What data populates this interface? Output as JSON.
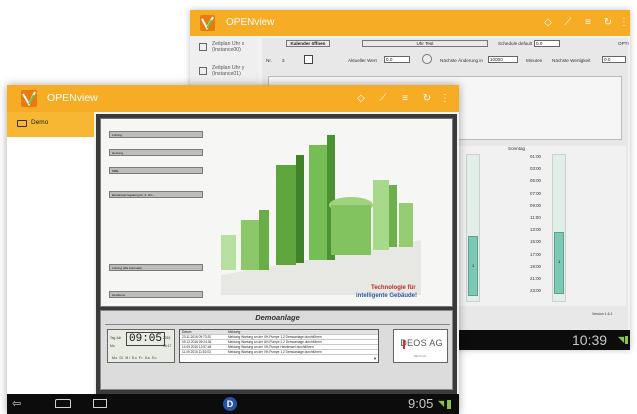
{
  "back_window": {
    "app_title": "OPENview",
    "sidebar_items": [
      {
        "label": "Zeitplan Uhr x (Instance00)"
      },
      {
        "label": "Zeitplan Uhr y (Instance01)"
      }
    ],
    "toolbar": {
      "kalender_button": "Kalender öffnen",
      "uhr_test_button": "Uhr Test",
      "schedule_default_label": "Schedule default",
      "schedule_default_value": "0.0",
      "opti_label": "OPTI",
      "nr_label": "Nr.",
      "nr_value": "3",
      "aktueller_wert_label": "Aktueller Wert",
      "aktueller_wert_value": "0.0",
      "naechste_aenderung_label": "Nächste Änderung in",
      "naechste_aenderung_value": "10000",
      "minuten_label": "Minuten",
      "naechste_wertigkeit_label": "Nächste Wertigkeit",
      "naechste_wertigkeit_value": "0.0"
    },
    "day_headers": [
      "onnerstag",
      "Freitag",
      "Samstag",
      "Sonntag"
    ],
    "times": [
      "01:00",
      "03:00",
      "05:00",
      "07:00",
      "09:00",
      "11:00",
      "13:00",
      "15:00",
      "17:00",
      "19:00",
      "21:00",
      "23:00"
    ],
    "schedule_bar_values": [
      "1",
      "1"
    ],
    "version_label": "Version 1.6.1",
    "clock": "10:39"
  },
  "front_window": {
    "app_title": "OPENview",
    "sidebar_items": [
      {
        "label": "Demo"
      }
    ],
    "hmi_buttons": [
      "Lüftung",
      "Heizung",
      "MBE",
      "Einzelraumregelung 01, 2. OG ...",
      "Lüftung (Ws Automati)",
      "Heizkurve"
    ],
    "hmi_caption_line1": "Technologie für",
    "hmi_caption_line2": "intelligente Gebäude!",
    "section_title": "Demoanlage",
    "clock_widget": {
      "time": "09:05",
      "row1_left": "Tag",
      "row1_mid": "Juli",
      "row1_right": "2016",
      "row2_left": "Mo",
      "row2_mid": "16:17",
      "days": "Mo Di Mi Do Fr Sa So"
    },
    "log_table": {
      "headers": [
        "Datum",
        "Meldung"
      ],
      "rows": [
        {
          "date": "23.11.2016 09:73:20",
          "msg": "Meldung Wartung an der VH-Pumpe 1,2 Demoanlage durchführen"
        },
        {
          "date": "09.12.2016 09:24:36",
          "msg": "Meldung Wartung an der UH-Pumpe 2.2 Demoanlage durchführen"
        },
        {
          "date": "14.09.2016 12:57:48",
          "msg": "Meldung Wartung an der VH-Pumpe Heizkessel durchführen"
        },
        {
          "date": "11.09.2016 11:52:03",
          "msg": "Meldung Wartung an der VH-Pumpe 1,2 Demoanlage durchführen"
        }
      ]
    },
    "brand_logo_text": "DEOS AG",
    "brand_tagline": "DEOS AG ...",
    "clock": "9:05",
    "center_badge": "D"
  },
  "colors": {
    "appbar": "#f6ac25",
    "logo_bg": "#e87b10",
    "sidebar_selected": "#f7b733",
    "navbar": "#0c0c0c",
    "status_accent": "#8bc34a",
    "schedule_bar": "#7fc8b5"
  },
  "icons": [
    "openview-logo-icon",
    "compass-icon",
    "trend-icon",
    "menu-lines-icon",
    "refresh-icon",
    "overflow-icon",
    "folder-icon",
    "back-nav-icon",
    "home-nav-icon",
    "recents-nav-icon",
    "wifi-icon",
    "battery-icon"
  ]
}
